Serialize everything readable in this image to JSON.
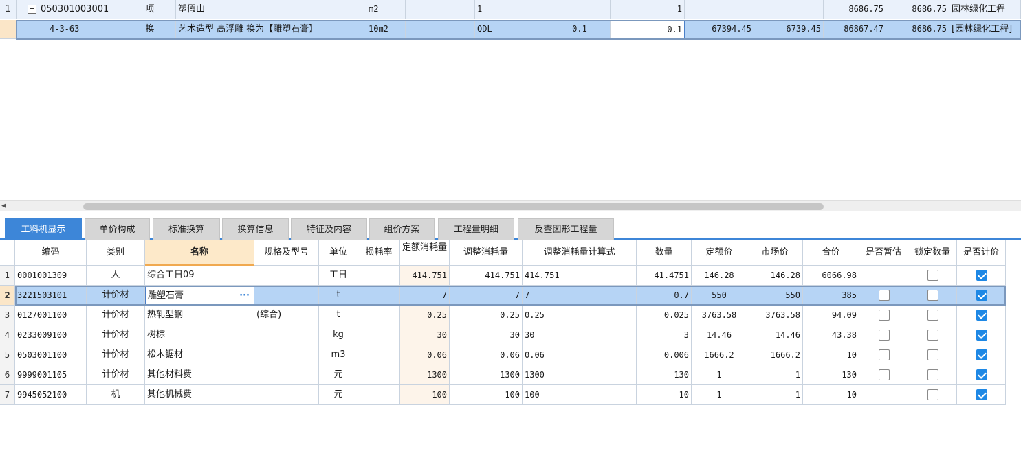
{
  "top_grid": {
    "rows": [
      {
        "row_no": "1",
        "code": "050301003001",
        "type": "项",
        "name": "塑假山",
        "unit": "m2",
        "c5": "",
        "c6": "1",
        "c7": "",
        "c8": "1",
        "c9": "",
        "c10": "",
        "c11": "8686.75",
        "c12": "8686.75",
        "c13": "园林绿化工程"
      },
      {
        "row_no": "",
        "code": "4-3-63",
        "type": "换",
        "name": "艺术造型 高浮雕  换为【雕塑石膏】",
        "unit": "10m2",
        "c5": "",
        "c6": "QDL",
        "c7": "0.1",
        "c8": "0.1",
        "c9": "67394.45",
        "c10": "6739.45",
        "c11": "86867.47",
        "c12": "8686.75",
        "c13": "[园林绿化工程]"
      }
    ]
  },
  "tabs": [
    "工料机显示",
    "单价构成",
    "标准换算",
    "换算信息",
    "特征及内容",
    "组价方案",
    "工程量明细",
    "反查图形工程量"
  ],
  "active_tab": 0,
  "bottom_grid": {
    "headers": [
      "编码",
      "类别",
      "名称",
      "规格及型号",
      "单位",
      "损耗率",
      "定额消耗量",
      "调整消耗量",
      "调整消耗量计算式",
      "数量",
      "定额价",
      "市场价",
      "合价",
      "是否暂估",
      "锁定数量",
      "是否计价"
    ],
    "rows": [
      {
        "no": "1",
        "code": "0001001309",
        "cat": "人",
        "name": "综合工日09",
        "spec": "",
        "unit": "工日",
        "loss": "",
        "quota": "414.751",
        "adj": "414.751",
        "formula": "414.751",
        "qty": "41.4751",
        "qprice": "146.28",
        "mprice": "146.28",
        "total": "6066.98",
        "est": null,
        "lock": false,
        "priced": true
      },
      {
        "no": "2",
        "code": "3221503101",
        "cat": "计价材",
        "name": "雕塑石膏",
        "spec": "",
        "unit": "t",
        "loss": "",
        "quota": "7",
        "adj": "7",
        "formula": "7",
        "qty": "0.7",
        "qprice": "550",
        "mprice": "550",
        "total": "385",
        "est": false,
        "lock": false,
        "priced": true
      },
      {
        "no": "3",
        "code": "0127001100",
        "cat": "计价材",
        "name": "热轧型钢",
        "spec": "(综合)",
        "unit": "t",
        "loss": "",
        "quota": "0.25",
        "adj": "0.25",
        "formula": "0.25",
        "qty": "0.025",
        "qprice": "3763.58",
        "mprice": "3763.58",
        "total": "94.09",
        "est": false,
        "lock": false,
        "priced": true
      },
      {
        "no": "4",
        "code": "0233009100",
        "cat": "计价材",
        "name": "树棕",
        "spec": "",
        "unit": "kg",
        "loss": "",
        "quota": "30",
        "adj": "30",
        "formula": "30",
        "qty": "3",
        "qprice": "14.46",
        "mprice": "14.46",
        "total": "43.38",
        "est": false,
        "lock": false,
        "priced": true
      },
      {
        "no": "5",
        "code": "0503001100",
        "cat": "计价材",
        "name": "松木锯材",
        "spec": "",
        "unit": "m3",
        "loss": "",
        "quota": "0.06",
        "adj": "0.06",
        "formula": "0.06",
        "qty": "0.006",
        "qprice": "1666.2",
        "mprice": "1666.2",
        "total": "10",
        "est": false,
        "lock": false,
        "priced": true
      },
      {
        "no": "6",
        "code": "9999001105",
        "cat": "计价材",
        "name": "其他材料费",
        "spec": "",
        "unit": "元",
        "loss": "",
        "quota": "1300",
        "adj": "1300",
        "formula": "1300",
        "qty": "130",
        "qprice": "1",
        "mprice": "1",
        "total": "130",
        "est": false,
        "lock": false,
        "priced": true
      },
      {
        "no": "7",
        "code": "9945052100",
        "cat": "机",
        "name": "其他机械费",
        "spec": "",
        "unit": "元",
        "loss": "",
        "quota": "100",
        "adj": "100",
        "formula": "100",
        "qty": "10",
        "qprice": "1",
        "mprice": "1",
        "total": "10",
        "est": null,
        "lock": false,
        "priced": true
      }
    ],
    "selected_row": 1,
    "ellipsis": "···"
  },
  "colors": {
    "accent": "#3d86d8",
    "selected_row": "#b6d4f5",
    "checkbox_on": "#1e88e5"
  }
}
